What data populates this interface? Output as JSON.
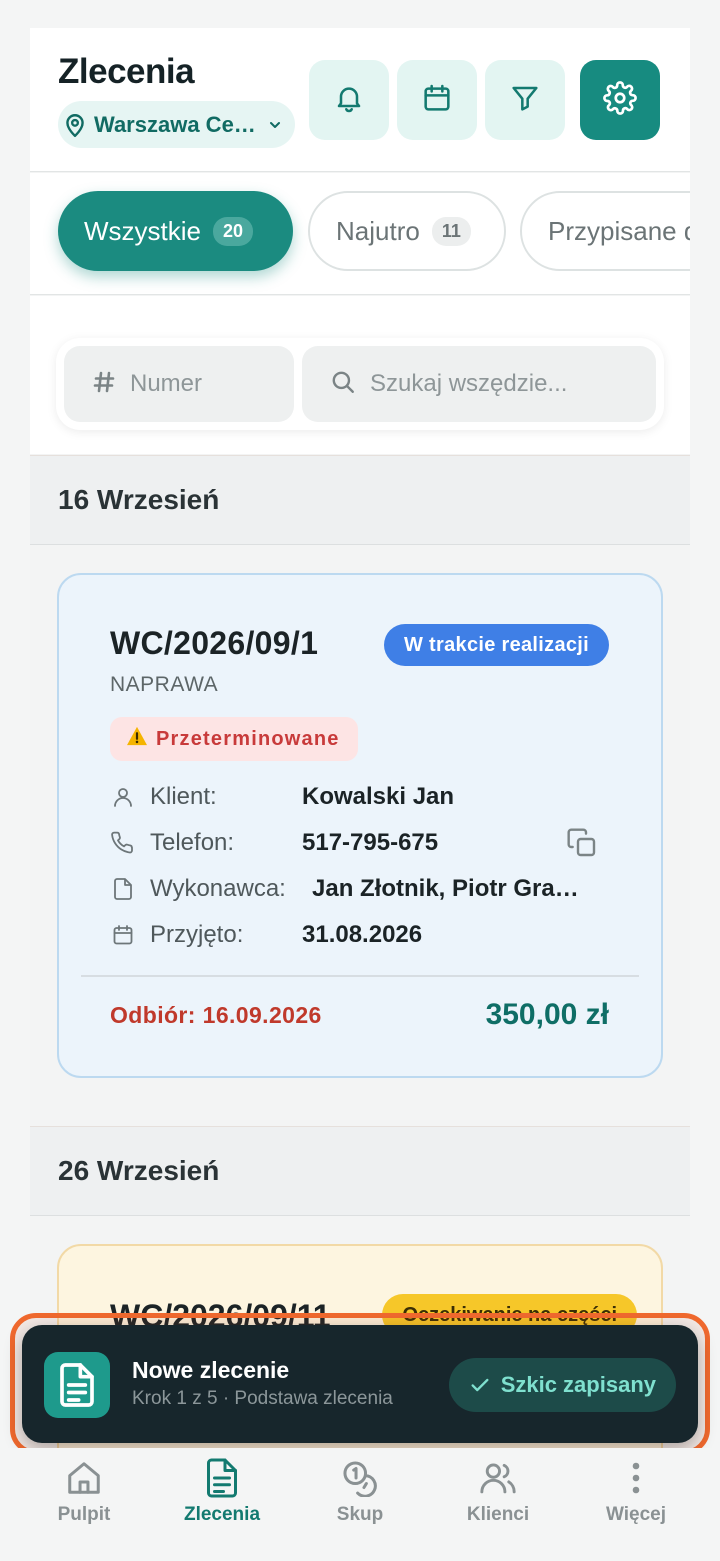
{
  "header": {
    "title": "Zlecenia",
    "location": "Warszawa Ce…"
  },
  "tabs": [
    {
      "label": "Wszystkie",
      "count": "20"
    },
    {
      "label": "Najutro",
      "count": "11"
    },
    {
      "label": "Przypisane d"
    }
  ],
  "search": {
    "number_placeholder": "Numer",
    "query_placeholder": "Szukaj wszędzie..."
  },
  "sections": [
    {
      "date": "16 Wrzesień",
      "order": {
        "number": "WC/2026/09/1",
        "status": "W trakcie realizacji",
        "type": "NAPRAWA",
        "flag": "Przeterminowane",
        "fields": [
          {
            "label": "Klient:",
            "value": "Kowalski Jan"
          },
          {
            "label": "Telefon:",
            "value": "517-795-675"
          },
          {
            "label": "Wykonawca:",
            "value": "Jan Złotnik, Piotr Gra…"
          },
          {
            "label": "Przyjęto:",
            "value": "31.08.2026"
          }
        ],
        "pickup": "Odbiór: 16.09.2026",
        "price": "350,00 zł"
      }
    },
    {
      "date": "26 Wrzesień",
      "order": {
        "number": "WC/2026/09/11",
        "status": "Oczekiwanie na części"
      }
    }
  ],
  "draft_toast": {
    "title": "Nowe zlecenie",
    "subtitle": "Krok 1 z 5 · Podstawa zlecenia",
    "saved_label": "Szkic zapisany"
  },
  "nav": [
    {
      "label": "Pulpit",
      "icon": "home-icon"
    },
    {
      "label": "Zlecenia",
      "icon": "document-icon",
      "active": true
    },
    {
      "label": "Skup",
      "icon": "coins-icon"
    },
    {
      "label": "Klienci",
      "icon": "users-icon"
    },
    {
      "label": "Więcej",
      "icon": "more-vertical-icon"
    }
  ],
  "colors": {
    "primary": "#178b80",
    "status_in_progress": "#3f7fe6",
    "status_waiting": "#f6c729",
    "overdue": "#c83a3a",
    "toast_bg": "#17262c",
    "highlight": "#f0692e"
  }
}
